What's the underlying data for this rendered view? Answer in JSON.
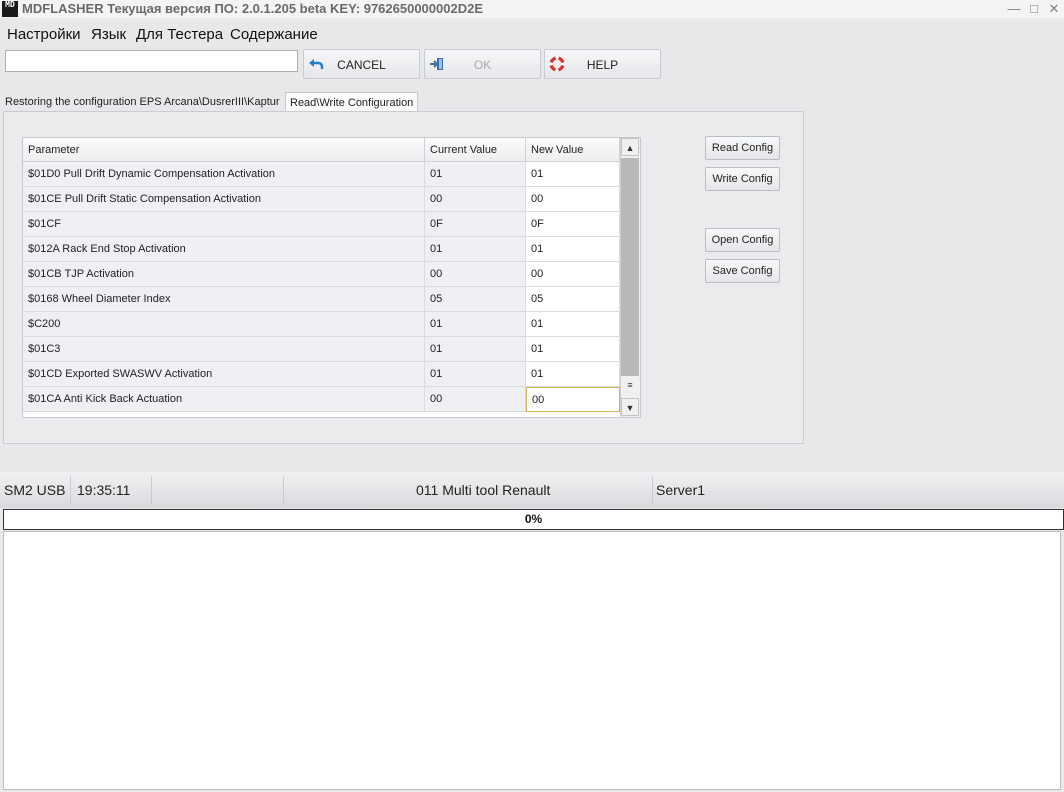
{
  "window": {
    "logo_text": "MD",
    "title": "MDFLASHER  Текущая версия ПО: 2.0.1.205 beta  KEY: 9762650000002D2E",
    "controls": [
      "—",
      "□",
      "✕"
    ]
  },
  "menu": [
    "Настройки",
    "Язык",
    "Для Тестера",
    "Содержание"
  ],
  "toolbar": {
    "search_value": "",
    "cancel_label": "CANCEL",
    "ok_label": "OK",
    "help_label": "HELP"
  },
  "tabs": [
    "Restoring the configuration EPS Arcana\\DusrerIII\\Kaptur",
    "Read\\Write Configuration"
  ],
  "grid": {
    "headers": [
      "Parameter",
      "Current Value",
      "New Value"
    ],
    "rows": [
      {
        "param": "$01D0 Pull Drift Dynamic Compensation Activation",
        "current": "01",
        "new": "01"
      },
      {
        "param": "$01CE Pull Drift Static Compensation Activation",
        "current": "00",
        "new": "00"
      },
      {
        "param": "$01CF",
        "current": "0F",
        "new": "0F"
      },
      {
        "param": "$012A Rack End Stop Activation",
        "current": "01",
        "new": "01"
      },
      {
        "param": "$01CB TJP Activation",
        "current": "00",
        "new": "00"
      },
      {
        "param": "$0168 Wheel Diameter Index",
        "current": "05",
        "new": "05"
      },
      {
        "param": "$C200",
        "current": "01",
        "new": "01"
      },
      {
        "param": "$01C3",
        "current": "01",
        "new": "01"
      },
      {
        "param": "$01CD Exported SWASWV Activation",
        "current": "01",
        "new": "01"
      },
      {
        "param": "$01CA Anti Kick Back Actuation",
        "current": "00",
        "new": "00"
      }
    ]
  },
  "side_buttons": {
    "read": "Read Config",
    "write": "Write Config",
    "open": "Open Config",
    "save": "Save Config"
  },
  "status": {
    "interface": "SM2 USB",
    "time": "19:35:11",
    "tool": "011 Multi tool Renault",
    "server": "Server1"
  },
  "progress": {
    "value": 0,
    "label": "0%"
  }
}
